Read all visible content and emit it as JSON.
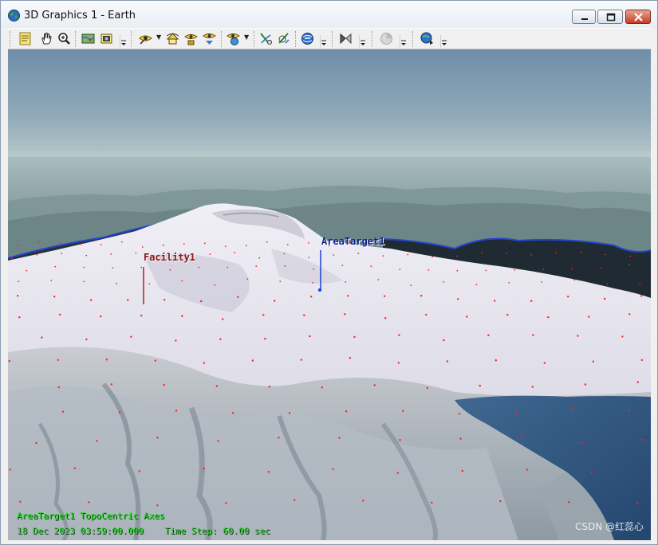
{
  "window": {
    "title": "3D Graphics 1 - Earth",
    "controls": [
      "minimize",
      "maximize",
      "close"
    ]
  },
  "toolbar": {
    "icons": [
      "properties-icon",
      "pan-hand-icon",
      "zoom-icon",
      "map-view-icon",
      "camera-icon",
      "view-from-eye-icon",
      "home-view-icon",
      "view-to-icon",
      "view-orient-icon",
      "globe-view-icon",
      "measure-icon",
      "measure-alt-icon",
      "globe-blue-icon",
      "mirror-icon",
      "disabled-globe-icon",
      "save-globe-icon"
    ]
  },
  "scene": {
    "facility_label": "Facility1",
    "area_label": "AreaTarget1",
    "hud_line1": "AreaTarget1 TopoCentric Axes",
    "hud_date": "18 Dec 2023 03:59:00.000",
    "hud_step": "Time Step: 60.00 sec",
    "watermark": "CSDN @红蕊心"
  },
  "colors": {
    "sky_top": "#6f8ea9",
    "sky_horizon": "#b4c6c9",
    "snow": "#e6e6ee",
    "lake": "#34577f",
    "facility_color": "#8b1313",
    "area_color": "#0e1f8f",
    "hud_green": "#22d922",
    "grid_dot": "#ff2020"
  }
}
